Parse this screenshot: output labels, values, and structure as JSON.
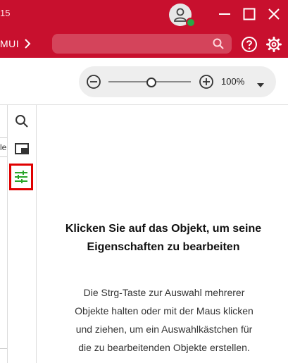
{
  "titlebar": {
    "title_fragment": "15",
    "breadcrumb": "MUI",
    "search": {
      "placeholder": ""
    },
    "colors": {
      "background": "#c8102e",
      "presence": "#27a745"
    },
    "icons": [
      "user-avatar-icon",
      "minimize-icon",
      "maximize-icon",
      "close-icon",
      "chevron-right-icon",
      "search-icon",
      "help-icon",
      "gear-icon"
    ]
  },
  "toolbar": {
    "zoom": {
      "value_label": "100%",
      "level_fraction": 0.5
    }
  },
  "left_pane": {
    "fragment": "le"
  },
  "sidebar": {
    "items": [
      {
        "icon": "search-icon",
        "active": false
      },
      {
        "icon": "panel-icon",
        "active": false
      },
      {
        "icon": "properties-sliders-icon",
        "active": true
      }
    ],
    "active_outline_color": "#e00000",
    "active_icon_color": "#2aa52a"
  },
  "properties_panel": {
    "heading_line1": "Klicken Sie auf das Objekt, um seine",
    "heading_line2": "Eigenschaften zu bearbeiten",
    "desc_line1": "Die Strg-Taste zur Auswahl mehrerer",
    "desc_line2": "Objekte halten oder mit der Maus klicken",
    "desc_line3": "und ziehen, um ein Auswahlkästchen für",
    "desc_line4": "die zu bearbeitenden Objekte erstellen."
  }
}
